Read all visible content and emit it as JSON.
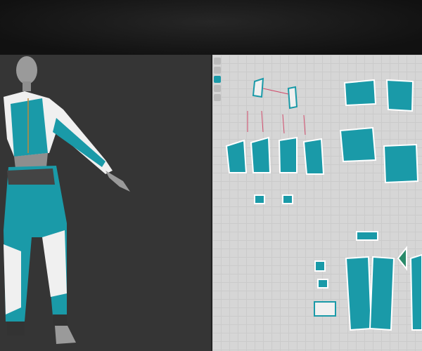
{
  "colors": {
    "garment": "#1a9aa8",
    "garment_dark": "#0f7580",
    "trim": "#f2f2f2",
    "avatar": "#9a9a9a",
    "viewport_3d": "#353535",
    "viewport_2d": "#d6d6d6"
  },
  "toolbar_2d": {
    "tools": [
      "transform-pattern-icon",
      "edit-point-icon",
      "fill-color-icon",
      "sewing-icon",
      "pin-icon"
    ]
  }
}
